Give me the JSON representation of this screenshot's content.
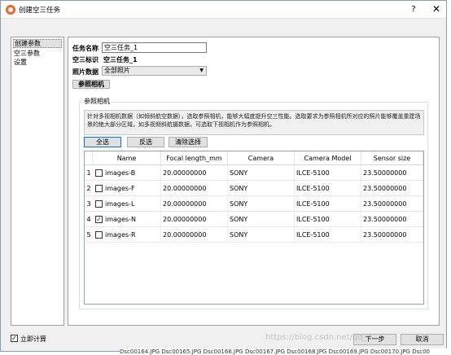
{
  "window": {
    "title": "创建空三任务",
    "help": "?",
    "close": "✕"
  },
  "nav": {
    "items": [
      "创建参数",
      "空三参数",
      "设置"
    ]
  },
  "form": {
    "task_name_label": "任务名称",
    "task_name_value": "空三任务_1",
    "aat_id_label": "空三标识",
    "aat_id_value": "空三任务_1",
    "photo_data_label": "照片数据",
    "photo_data_value": "全部照片",
    "ref_camera_button": "参照相机"
  },
  "group": {
    "title": "参照相机",
    "description": "针对多视相机数据（如倾斜航空数据），选取参照相机，能够大幅度提升空三性能。选取要求为参照相机所对应的照片能够覆盖重建场景的绝大部分区域，如多视倾斜航摄数据，可选取下视相机作为参照相机。",
    "select_all": "全选",
    "invert": "反选",
    "clear": "清除选择"
  },
  "table": {
    "headers": [
      "Name",
      "Focal length_mm",
      "Camera",
      "Camera Model",
      "Sensor size"
    ],
    "rows": [
      {
        "num": "1",
        "checked": false,
        "name": "images-B",
        "focal": "20.00000000",
        "camera": "SONY",
        "model": "ILCE-5100",
        "sensor": "23.50000000"
      },
      {
        "num": "2",
        "checked": false,
        "name": "images-F",
        "focal": "20.00000000",
        "camera": "SONY",
        "model": "ILCE-5100",
        "sensor": "23.50000000"
      },
      {
        "num": "3",
        "checked": false,
        "name": "images-L",
        "focal": "20.00000000",
        "camera": "SONY",
        "model": "ILCE-5100",
        "sensor": "23.50000000"
      },
      {
        "num": "4",
        "checked": true,
        "name": "images-N",
        "focal": "20.00000000",
        "camera": "SONY",
        "model": "ILCE-5100",
        "sensor": "23.50000000"
      },
      {
        "num": "5",
        "checked": false,
        "name": "images-R",
        "focal": "20.00000000",
        "camera": "SONY",
        "model": "ILCE-5100",
        "sensor": "23.50000000"
      }
    ]
  },
  "footer": {
    "compute_now": "立即计算",
    "compute_checked": true,
    "next": "下一步",
    "cancel": "取消"
  },
  "background": {
    "file_strip": "Dsc00164.JPG  Dsc00165.JPG  Dsc00166.JPG  Dsc00167.JPG  Dsc00168.JPG  Dsc00169.JPG  Dsc00170.JPG  Dsc00"
  },
  "watermark": "https://blog.csdn.net/qq_4..."
}
